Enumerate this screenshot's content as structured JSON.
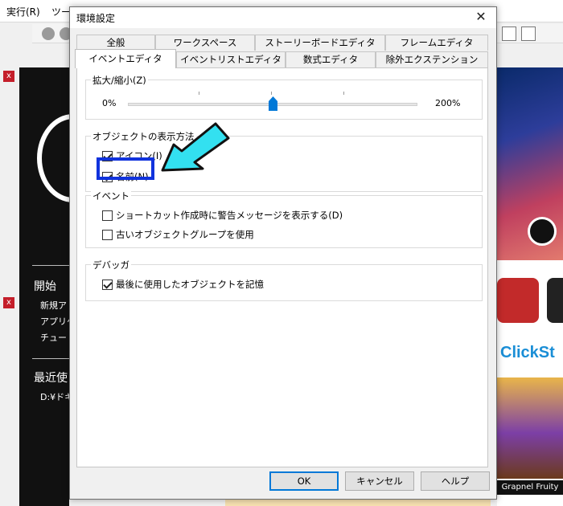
{
  "background": {
    "menu": [
      "実行(R)",
      "ツー"
    ],
    "left_panel": {
      "start_heading": "開始",
      "start_items": [
        "新規ア",
        "アプリケ",
        "チュート"
      ],
      "recent_heading": "最近使",
      "recent_items": [
        "D:¥ドキ"
      ]
    },
    "right_ads": {
      "brand_text": "ClickSt",
      "game_caption": "Grapnel Fruity"
    }
  },
  "dialog": {
    "title": "環境設定",
    "tabs_row1": [
      "全般",
      "ワークスペース",
      "ストーリーボードエディタ",
      "フレームエディタ"
    ],
    "tabs_row2": [
      "イベントエディタ",
      "イベントリストエディタ",
      "数式エディタ",
      "除外エクステンション"
    ],
    "active_tab": "イベントエディタ",
    "zoom": {
      "label": "拡大/縮小(Z)",
      "min_label": "0%",
      "max_label": "200%",
      "value_fraction": 0.5
    },
    "object_display": {
      "label": "オブジェクトの表示方法",
      "options": [
        {
          "label": "アイコン(I)",
          "checked": true
        },
        {
          "label": "名前(N)",
          "checked": true
        }
      ]
    },
    "event": {
      "label": "イベント",
      "options": [
        {
          "label": "ショートカット作成時に警告メッセージを表示する(D)",
          "checked": false
        },
        {
          "label": "古いオブジェクトグループを使用",
          "checked": false
        }
      ]
    },
    "debugger": {
      "label": "デバッガ",
      "options": [
        {
          "label": "最後に使用したオブジェクトを記憶",
          "checked": true
        }
      ]
    },
    "buttons": {
      "ok": "OK",
      "cancel": "キャンセル",
      "help": "ヘルプ"
    }
  },
  "colors": {
    "highlight": "#1133dd",
    "arrow": "#33e0f0",
    "slider_thumb": "#0078d7"
  }
}
